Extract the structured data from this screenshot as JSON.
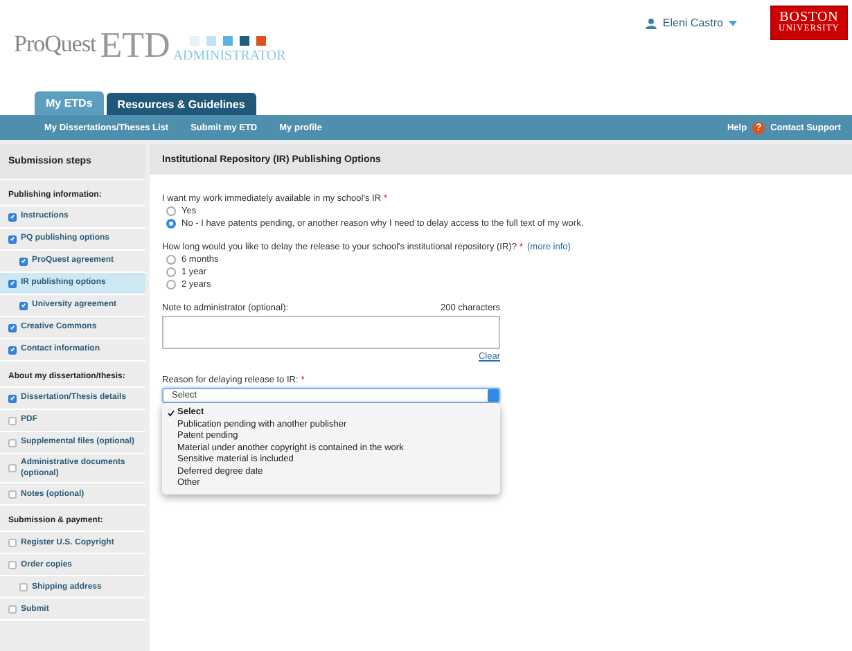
{
  "header": {
    "logo": {
      "brand": "ProQuest",
      "product": "ETD",
      "subtitle": "ADMINISTRATOR"
    },
    "user": "Eleni Castro",
    "university": [
      "BOSTON",
      "UNIVERSITY"
    ]
  },
  "tabs": [
    {
      "label": "My ETDs",
      "selected": true
    },
    {
      "label": "Resources & Guidelines",
      "selected": false
    }
  ],
  "nav": {
    "items": [
      "My Dissertations/Theses List",
      "Submit my ETD",
      "My profile"
    ],
    "help": "Help",
    "help_icon": "?",
    "support": "Contact Support"
  },
  "sidebar": {
    "title": "Submission steps",
    "sections": [
      {
        "heading": "Publishing information:",
        "items": [
          {
            "label": "Instructions",
            "checked": true,
            "selected": false
          },
          {
            "label": "PQ publishing options",
            "checked": true,
            "selected": false,
            "children": [
              {
                "label": "ProQuest agreement",
                "checked": true,
                "selected": false
              }
            ]
          },
          {
            "label": "IR publishing options",
            "checked": true,
            "selected": true,
            "children": [
              {
                "label": "University agreement",
                "checked": true,
                "selected": false
              }
            ]
          },
          {
            "label": "Creative Commons",
            "checked": true,
            "selected": false
          },
          {
            "label": "Contact information",
            "checked": true,
            "selected": false
          }
        ]
      },
      {
        "heading": "About my dissertation/thesis:",
        "items": [
          {
            "label": "Dissertation/Thesis details",
            "checked": true,
            "selected": false
          },
          {
            "label": "PDF",
            "checked": false,
            "selected": false
          },
          {
            "label": "Supplemental files (optional)",
            "checked": false,
            "selected": false
          },
          {
            "label": "Administrative documents (optional)",
            "checked": false,
            "selected": false
          },
          {
            "label": "Notes (optional)",
            "checked": false,
            "selected": false
          }
        ]
      },
      {
        "heading": "Submission & payment:",
        "items": [
          {
            "label": "Register U.S. Copyright",
            "checked": false,
            "selected": false
          },
          {
            "label": "Order copies",
            "checked": false,
            "selected": false,
            "children": [
              {
                "label": "Shipping address",
                "checked": false,
                "selected": false
              }
            ]
          },
          {
            "label": "Submit",
            "checked": false,
            "selected": false
          }
        ]
      }
    ]
  },
  "content": {
    "title": "Institutional Repository (IR) Publishing Options",
    "questions": [
      {
        "label": "I want my work immediately available in my school's IR",
        "required": "*",
        "options": [
          {
            "label": "Yes",
            "selected": false
          },
          {
            "label": "No - I have patents pending, or another reason why I need to delay access to the full text of my work.",
            "selected": true
          }
        ]
      },
      {
        "label": "How long would you like to delay the release to your school's institutional repository (IR)?",
        "required": "*",
        "link": "(more info)",
        "options": [
          {
            "label": "6 months",
            "selected": false
          },
          {
            "label": "1 year",
            "selected": false
          },
          {
            "label": "2 years",
            "selected": false
          }
        ]
      }
    ],
    "note": {
      "label": "Note to administrator (optional):",
      "counter": "200 characters",
      "clear": "Clear"
    },
    "reason": {
      "label": "Reason for delaying release to IR:",
      "required": "*",
      "value": "Select",
      "options": [
        {
          "label": "Select",
          "selected": true
        },
        {
          "label": "Publication pending with another publisher",
          "selected": false
        },
        {
          "label": "Patent pending",
          "selected": false
        },
        {
          "label": "Material under another copyright is contained in the work",
          "selected": false
        },
        {
          "label": "Sensitive material is included",
          "selected": false
        },
        {
          "label": "Deferred degree date",
          "selected": false
        },
        {
          "label": "Other",
          "selected": false
        }
      ]
    }
  }
}
